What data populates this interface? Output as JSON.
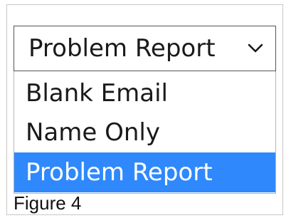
{
  "select": {
    "value": "Problem Report",
    "icon": "chevron-down-icon"
  },
  "options": [
    {
      "label": "Blank Email",
      "selected": false
    },
    {
      "label": "Name Only",
      "selected": false
    },
    {
      "label": "Problem Report",
      "selected": true
    }
  ],
  "caption": "Figure 4",
  "colors": {
    "selected_bg": "#2f89fc",
    "selected_text": "#ffffff",
    "border": "#555555"
  }
}
